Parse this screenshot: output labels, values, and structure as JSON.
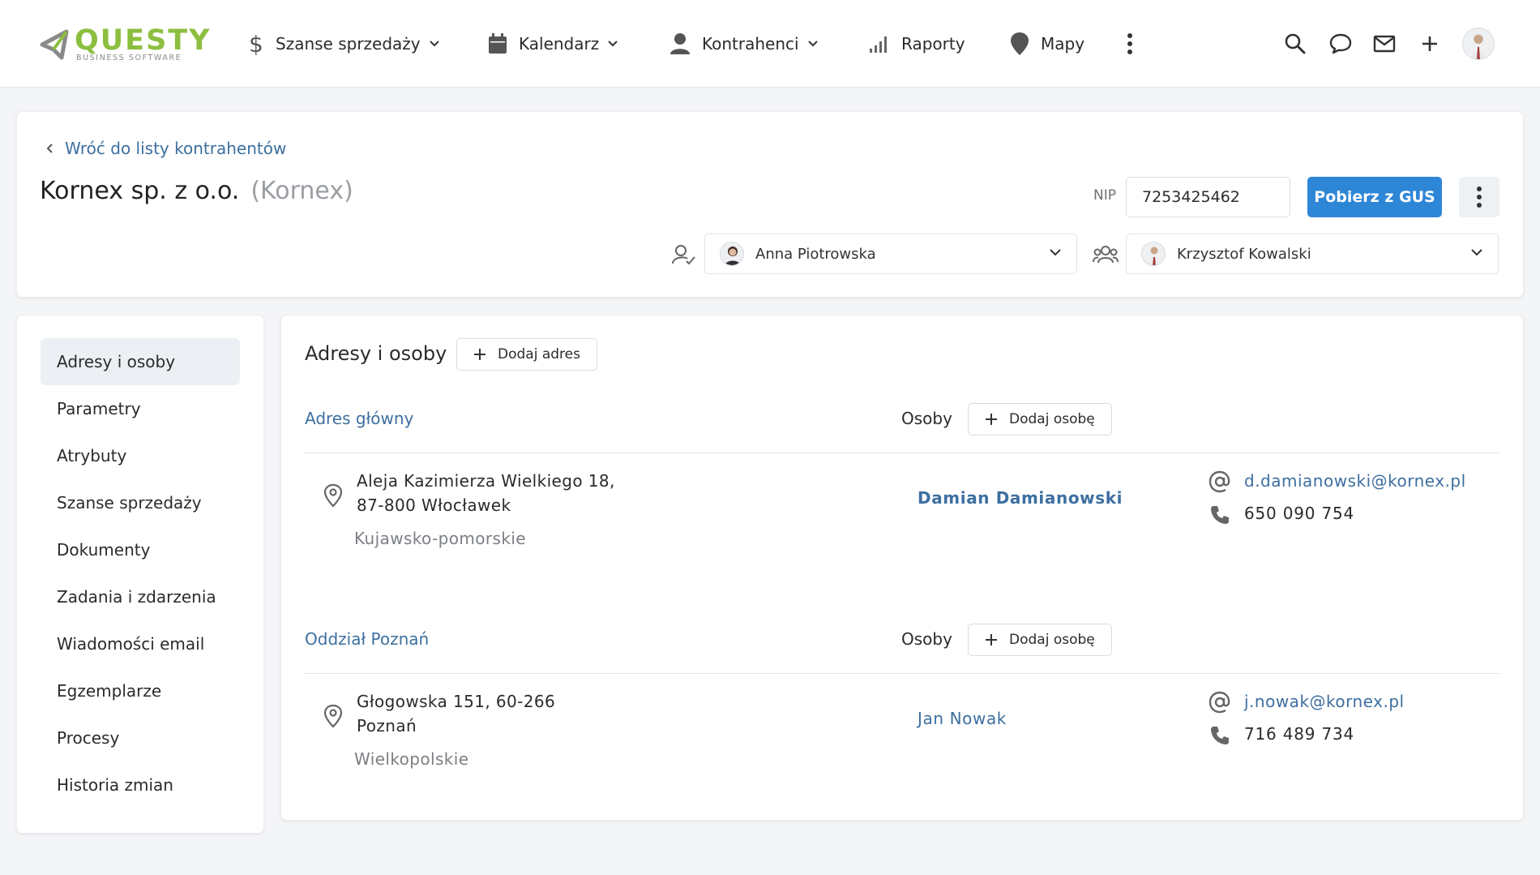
{
  "app": {
    "logo_text": "QUESTY",
    "logo_subtext": "BUSINESS SOFTWARE",
    "brand_color": "#8cbf3f",
    "accent_color": "#2e86d6",
    "link_color": "#3d6fa0"
  },
  "nav": {
    "items": [
      {
        "label": "Szanse sprzedaży",
        "icon": "dollar-icon",
        "has_dropdown": true
      },
      {
        "label": "Kalendarz",
        "icon": "calendar-icon",
        "has_dropdown": true
      },
      {
        "label": "Kontrahenci",
        "icon": "person-icon",
        "has_dropdown": true
      },
      {
        "label": "Raporty",
        "icon": "signal-bars-icon",
        "has_dropdown": false
      },
      {
        "label": "Mapy",
        "icon": "map-pin-icon",
        "has_dropdown": false
      }
    ],
    "right_icons": [
      "search-icon",
      "chat-icon",
      "mail-icon",
      "plus-icon",
      "user-avatar"
    ]
  },
  "header": {
    "back_link": "Wróć do listy kontrahentów",
    "company_name": "Kornex sp. z o.o.",
    "company_alias": "(Kornex)",
    "nip_label": "NIP",
    "nip_value": "7253425462",
    "gus_button": "Pobierz z GUS",
    "owner": "Anna Piotrowska",
    "team_member": "Krzysztof Kowalski"
  },
  "sidebar": {
    "items": [
      {
        "label": "Adresy i osoby",
        "active": true
      },
      {
        "label": "Parametry",
        "active": false
      },
      {
        "label": "Atrybuty",
        "active": false
      },
      {
        "label": "Szanse sprzedaży",
        "active": false
      },
      {
        "label": "Dokumenty",
        "active": false
      },
      {
        "label": "Zadania i zdarzenia",
        "active": false
      },
      {
        "label": "Wiadomości email",
        "active": false
      },
      {
        "label": "Egzemplarze",
        "active": false
      },
      {
        "label": "Procesy",
        "active": false
      },
      {
        "label": "Historia zmian",
        "active": false
      }
    ]
  },
  "main": {
    "title": "Adresy i osoby",
    "add_address_button": "Dodaj adres",
    "osoby_label": "Osoby",
    "add_person_button": "Dodaj osobę",
    "addresses": [
      {
        "title": "Adres główny",
        "line1": "Aleja Kazimierza Wielkiego 18,",
        "line2": "87-800 Włocławek",
        "region": "Kujawsko-pomorskie",
        "person": "Damian Damianowski",
        "email": "d.damianowski@kornex.pl",
        "phone": "650 090 754"
      },
      {
        "title": "Oddział Poznań",
        "line1": "Głogowska 151, 60-266",
        "line2": "Poznań",
        "region": "Wielkopolskie",
        "person": "Jan Nowak",
        "email": "j.nowak@kornex.pl",
        "phone": "716 489 734"
      }
    ]
  }
}
